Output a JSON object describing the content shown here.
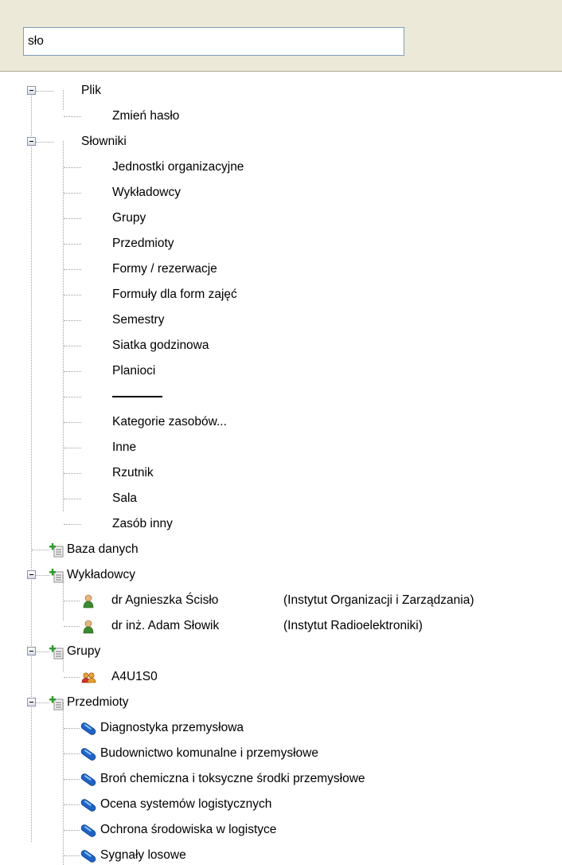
{
  "search": {
    "value": "sło"
  },
  "menu": [
    {
      "label": "Plik",
      "children": [
        "Zmień hasło"
      ]
    },
    {
      "label": "Słowniki",
      "children": [
        "Jednostki organizacyjne",
        "Wykładowcy",
        "Grupy",
        "Przedmioty",
        "Formy / rezerwacje",
        "Formuły dla form zajęć",
        "Semestry",
        "Siatka godzinowa",
        "Planioci",
        "",
        "Kategorie zasobów...",
        "Inne",
        "Rzutnik",
        "Sala",
        "Zasób inny"
      ]
    }
  ],
  "database": {
    "label": "Baza danych"
  },
  "lecturers": {
    "label": "Wykładowcy",
    "items": [
      {
        "name": "dr Agnieszka Ścisło",
        "unit": "(Instytut Organizacji i Zarządzania)"
      },
      {
        "name": "dr inż. Adam Słowik",
        "unit": "(Instytut Radioelektroniki)"
      }
    ]
  },
  "groups": {
    "label": "Grupy",
    "items": [
      "A4U1S0"
    ]
  },
  "subjects": {
    "label": "Przedmioty",
    "items": [
      "Diagnostyka przemysłowa",
      "Budownictwo komunalne i przemysłowe",
      "Broń chemiczna i toksyczne środki przemysłowe",
      "Ocena systemów logistycznych",
      "Ochrona środowiska w logistyce",
      "Sygnały losowe"
    ]
  },
  "colors": {
    "toolbar_bg": "#ece9d8",
    "input_border": "#7f9db9",
    "tree_lines": "#a0a0a0",
    "node_icon_green": "#2a9d2a",
    "person_green": "#3a8a2e",
    "pill_blue": "#1c64c8"
  },
  "icons": {
    "expanded": "minus-box-icon",
    "category": "tree-add-icon",
    "lecturer": "person-icon",
    "group": "group-icon",
    "subject": "pill-icon"
  }
}
